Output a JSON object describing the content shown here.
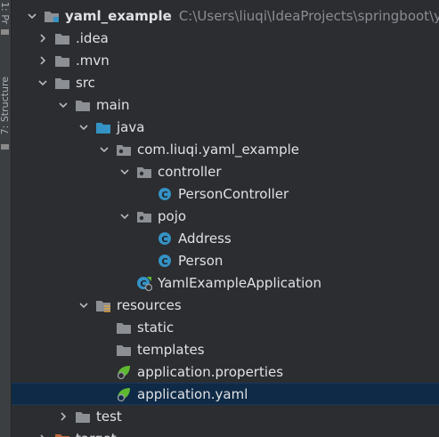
{
  "side_panel": {
    "label_top": "1: Pr",
    "label_mid": "7: Structure"
  },
  "project_tree": {
    "root": {
      "name": "yaml_example",
      "path": "C:\\Users\\liuqi\\IdeaProjects\\springboot\\yaml"
    },
    "items": [
      {
        "label": ".idea"
      },
      {
        "label": ".mvn"
      },
      {
        "label": "src"
      },
      {
        "label": "main"
      },
      {
        "label": "java"
      },
      {
        "label": "com.liuqi.yaml_example"
      },
      {
        "label": "controller"
      },
      {
        "label": "PersonController"
      },
      {
        "label": "pojo"
      },
      {
        "label": "Address"
      },
      {
        "label": "Person"
      },
      {
        "label": "YamlExampleApplication"
      },
      {
        "label": "resources"
      },
      {
        "label": "static"
      },
      {
        "label": "templates"
      },
      {
        "label": "application.properties"
      },
      {
        "label": "application.yaml"
      },
      {
        "label": "test"
      },
      {
        "label": "target"
      }
    ]
  },
  "colors": {
    "background": "#2b2d30",
    "selection": "#0f2a46",
    "folder": "#8c8f94",
    "source_folder": "#3592c4",
    "class_icon": "#3592c4",
    "spring_green": "#5fb832",
    "excluded_folder": "#c16a3f"
  }
}
